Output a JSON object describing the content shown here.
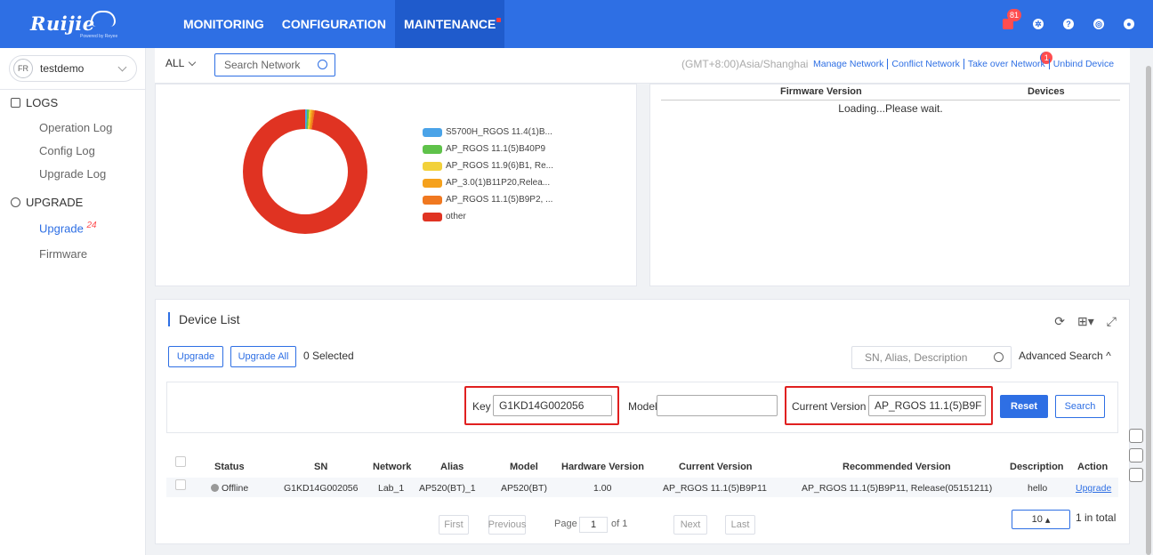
{
  "brand": {
    "logo_text": "Ruijie",
    "logo_sub": "Powered by Reyee"
  },
  "nav": {
    "monitoring": "MONITORING",
    "configuration": "CONFIGURATION",
    "maintenance": "MAINTENANCE"
  },
  "header": {
    "notifications_count": "81"
  },
  "sidebar": {
    "project_initials": "FR",
    "project_name": "testdemo",
    "logs_label": "LOGS",
    "operation_log": "Operation Log",
    "config_log": "Config Log",
    "upgrade_log": "Upgrade Log",
    "upgrade_group": "UPGRADE",
    "upgrade_item": "Upgrade",
    "upgrade_count": "24",
    "firmware_item": "Firmware"
  },
  "filter": {
    "scope": "ALL",
    "search_placeholder": "Search Network",
    "timezone": "(GMT+8:00)Asia/Shanghai",
    "manage_network": "Manage Network",
    "conflict_network": "Conflict Network",
    "take_over_network": "Take over Network",
    "take_over_badge": "1",
    "unbind_device": "Unbind Device"
  },
  "chart_data": {
    "type": "pie",
    "categories": [
      "S5700H_RGOS 11.4(1)B...",
      "AP_RGOS 11.1(5)B40P9",
      "AP_RGOS 11.9(6)B1, Re...",
      "AP_3.0(1)B11P20,Relea...",
      "AP_RGOS 11.1(5)B9P2, ...",
      "other"
    ],
    "values": [
      0.5,
      0.5,
      0.5,
      0.5,
      0.5,
      97.5
    ],
    "colors": [
      "#4aa3e8",
      "#5fc24a",
      "#f2d13a",
      "#f5a11c",
      "#f07820",
      "#e03322"
    ],
    "legend_position": "right"
  },
  "firmware_panel": {
    "col_firmware": "Firmware Version",
    "col_devices": "Devices",
    "loading": "Loading...Please wait."
  },
  "device_list": {
    "title": "Device List",
    "upgrade_btn": "Upgrade",
    "upgrade_all_btn": "Upgrade All",
    "selected": "0 Selected",
    "search_placeholder": "SN, Alias, Description",
    "advanced_search": "Advanced Search",
    "key_label": "Key",
    "key_value": "G1KD14G002056",
    "model_label": "Model",
    "model_value": "",
    "current_version_label": "Current Version",
    "current_version_value": "AP_RGOS 11.1(5)B9F",
    "reset_btn": "Reset",
    "search_btn": "Search",
    "columns": [
      "Status",
      "SN",
      "Network",
      "Alias",
      "Model",
      "Hardware Version",
      "Current Version",
      "Recommended Version",
      "Description",
      "Action"
    ],
    "rows": [
      [
        "Offline",
        "G1KD14G002056",
        "Lab_1",
        "AP520(BT)_1",
        "AP520(BT)",
        "1.00",
        "AP_RGOS 11.1(5)B9P11",
        "AP_RGOS 11.1(5)B9P11, Release(05151211)",
        "hello",
        "Upgrade"
      ]
    ],
    "pagination": {
      "first": "First",
      "previous": "Previous",
      "page_label": "Page",
      "page": "1",
      "of": "of 1",
      "next": "Next",
      "last": "Last",
      "page_size": "10",
      "total": "1 in total"
    }
  }
}
